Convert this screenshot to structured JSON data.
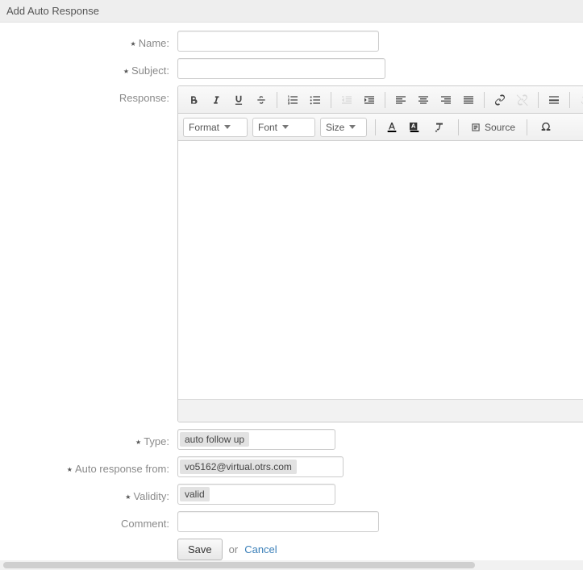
{
  "header": {
    "title": "Add Auto Response"
  },
  "labels": {
    "name": "Name:",
    "subject": "Subject:",
    "response": "Response:",
    "type": "Type:",
    "auto_response_from": "Auto response from:",
    "validity": "Validity:",
    "comment": "Comment:"
  },
  "fields": {
    "name": "",
    "subject": "",
    "type": "auto follow up",
    "auto_response_from": "vo5162@virtual.otrs.com",
    "validity": "valid",
    "comment": ""
  },
  "toolbar": {
    "format_label": "Format",
    "font_label": "Font",
    "size_label": "Size",
    "source_label": "Source",
    "icons": {
      "bold": "bold-icon",
      "italic": "italic-icon",
      "underline": "underline-icon",
      "strike": "strike-icon",
      "ol": "ordered-list-icon",
      "ul": "unordered-list-icon",
      "outdent": "outdent-icon",
      "indent": "indent-icon",
      "align_left": "align-left-icon",
      "align_center": "align-center-icon",
      "align_right": "align-right-icon",
      "justify": "justify-icon",
      "link": "link-icon",
      "unlink": "unlink-icon",
      "hr": "horizontal-rule-icon",
      "undo": "undo-icon",
      "text_color": "text-color-icon",
      "bg_color": "background-color-icon",
      "remove_format": "remove-format-icon",
      "source": "source-icon",
      "special_char": "special-char-icon"
    }
  },
  "actions": {
    "save": "Save",
    "or": "or",
    "cancel": "Cancel"
  }
}
